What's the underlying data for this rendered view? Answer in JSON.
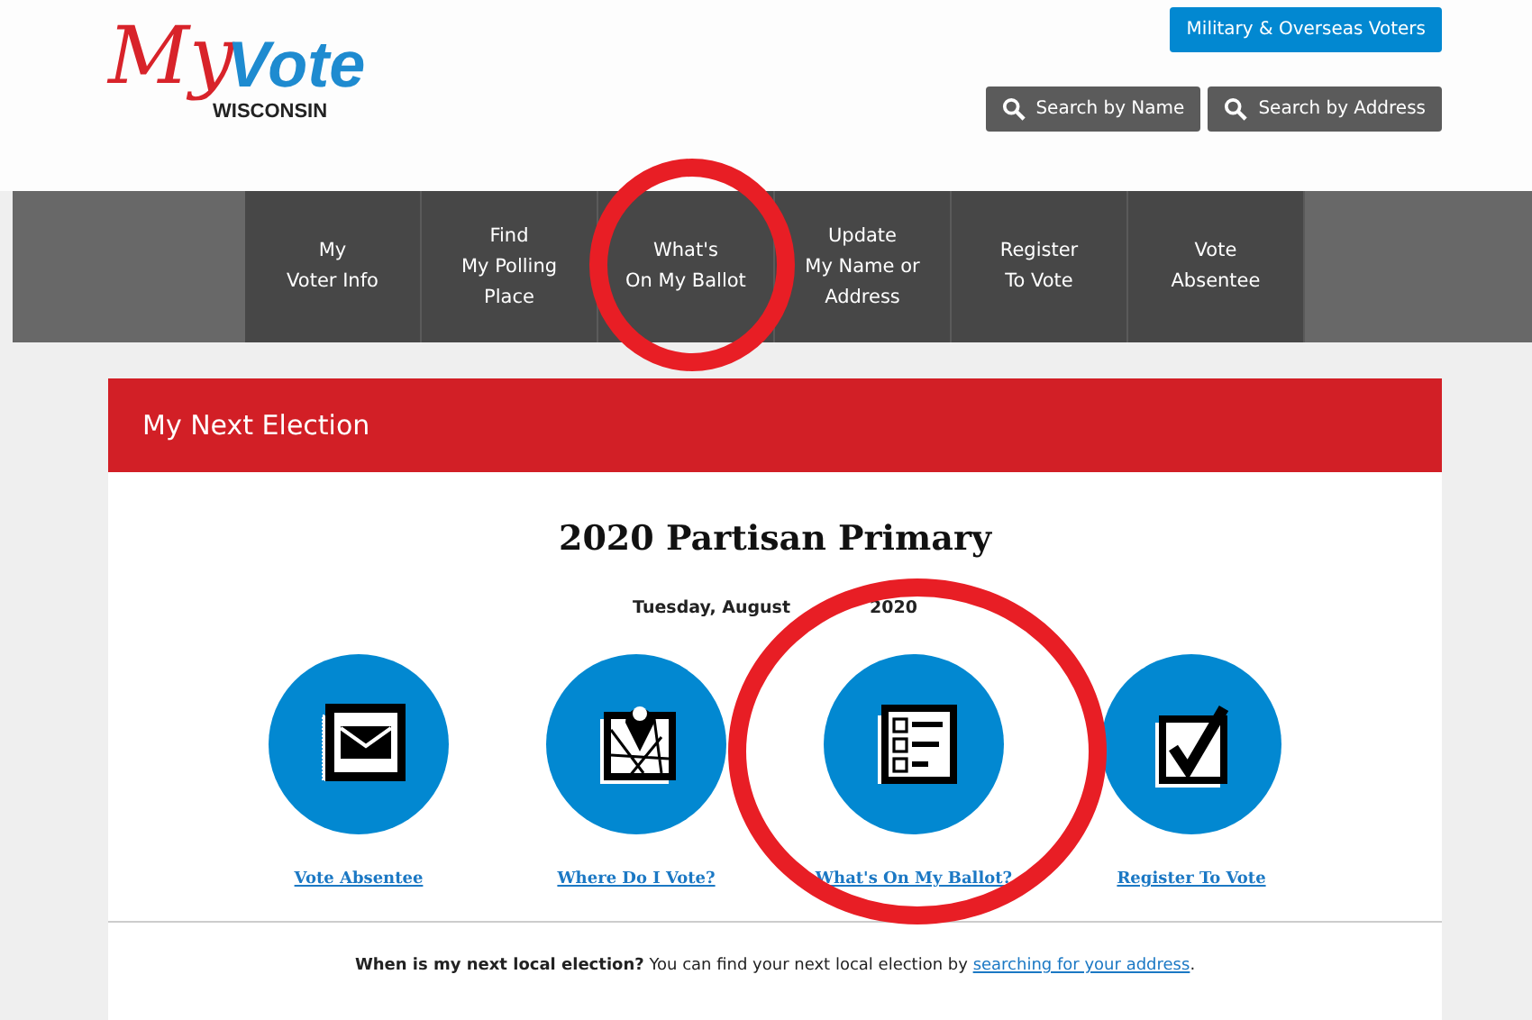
{
  "logo": {
    "my": "My",
    "vote": "Vote",
    "state": "WISCONSIN"
  },
  "header_buttons": [
    {
      "kind": "primary",
      "label": "Military & Overseas Voters"
    },
    {
      "kind": "search",
      "label": "Search by Name"
    },
    {
      "kind": "search",
      "label": "Search by Address"
    }
  ],
  "nav": [
    {
      "lines": [
        "My",
        "Voter Info"
      ]
    },
    {
      "lines": [
        "Find",
        "My Polling",
        "Place"
      ]
    },
    {
      "lines": [
        "What's",
        "On My Ballot"
      ]
    },
    {
      "lines": [
        "Update",
        "My Name or",
        "Address"
      ]
    },
    {
      "lines": [
        "Register",
        "To Vote"
      ]
    },
    {
      "lines": [
        "Vote",
        "Absentee"
      ]
    }
  ],
  "panel": {
    "title": "My Next Election",
    "election": "2020 Partisan Primary",
    "date_parts": [
      "Tuesday, August",
      "2020"
    ],
    "actions": [
      {
        "kind": "envelope",
        "label": "Vote Absentee"
      },
      {
        "kind": "map",
        "label": "Where Do I Vote?"
      },
      {
        "kind": "ballot",
        "label": "What's On My Ballot?"
      },
      {
        "kind": "check",
        "label": "Register To Vote"
      }
    ],
    "footer": {
      "question": "When is my next local election?",
      "text": "You can find your next local election by",
      "link": "searching for your address",
      "end": "."
    }
  }
}
